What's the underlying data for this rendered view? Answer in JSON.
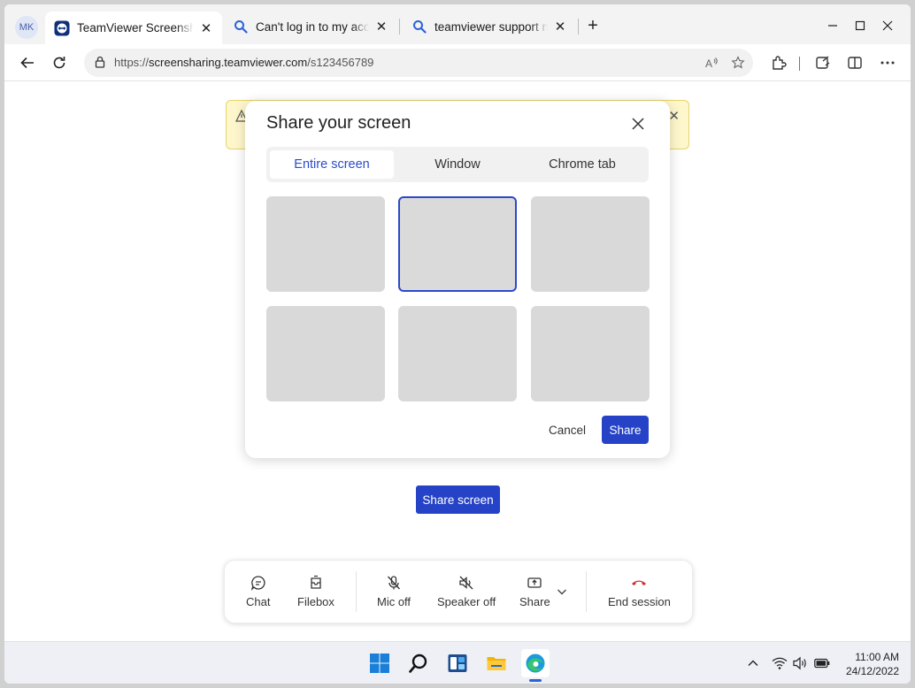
{
  "browser": {
    "profile_initials": "MK",
    "tabs": [
      {
        "title": "TeamViewer Screensharing",
        "icon": "teamviewer-icon",
        "active": true
      },
      {
        "title": "Can't log in to my account",
        "icon": "search-icon",
        "active": false
      },
      {
        "title": "teamviewer support number",
        "icon": "search-icon",
        "active": false
      }
    ],
    "url_prefix": "https://",
    "url_host": "screensharing.teamviewer.com",
    "url_path": "/s123456789"
  },
  "dialog": {
    "title": "Share your screen",
    "tabs": [
      {
        "label": "Entire screen",
        "active": true
      },
      {
        "label": "Window",
        "active": false
      },
      {
        "label": "Chrome tab",
        "active": false
      }
    ],
    "selected_thumbnail": 2,
    "cancel_label": "Cancel",
    "share_label": "Share"
  },
  "page": {
    "share_screen_label": "Share screen",
    "controls": {
      "chat": "Chat",
      "filebox": "Filebox",
      "mic": "Mic off",
      "speaker": "Speaker off",
      "share": "Share",
      "end": "End session"
    }
  },
  "taskbar": {
    "time": "11:00 AM",
    "date": "24/12/2022"
  },
  "colors": {
    "accent": "#2643c7",
    "end_session": "#d32f2f"
  }
}
